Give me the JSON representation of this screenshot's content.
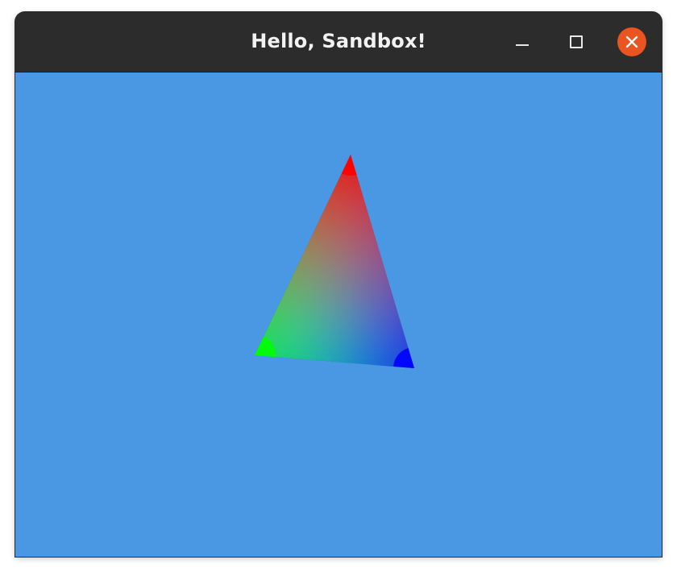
{
  "window": {
    "title": "Hello, Sandbox!"
  },
  "controls": {
    "minimize_icon": "minimize-icon",
    "maximize_icon": "maximize-icon",
    "close_icon": "close-icon"
  },
  "colors": {
    "titlebar": "#2c2c2c",
    "clear_color": "#4a98e3",
    "close_button": "#e95420",
    "vertex_top": "#ff0000",
    "vertex_left": "#00ff00",
    "vertex_right": "#0000ff"
  }
}
